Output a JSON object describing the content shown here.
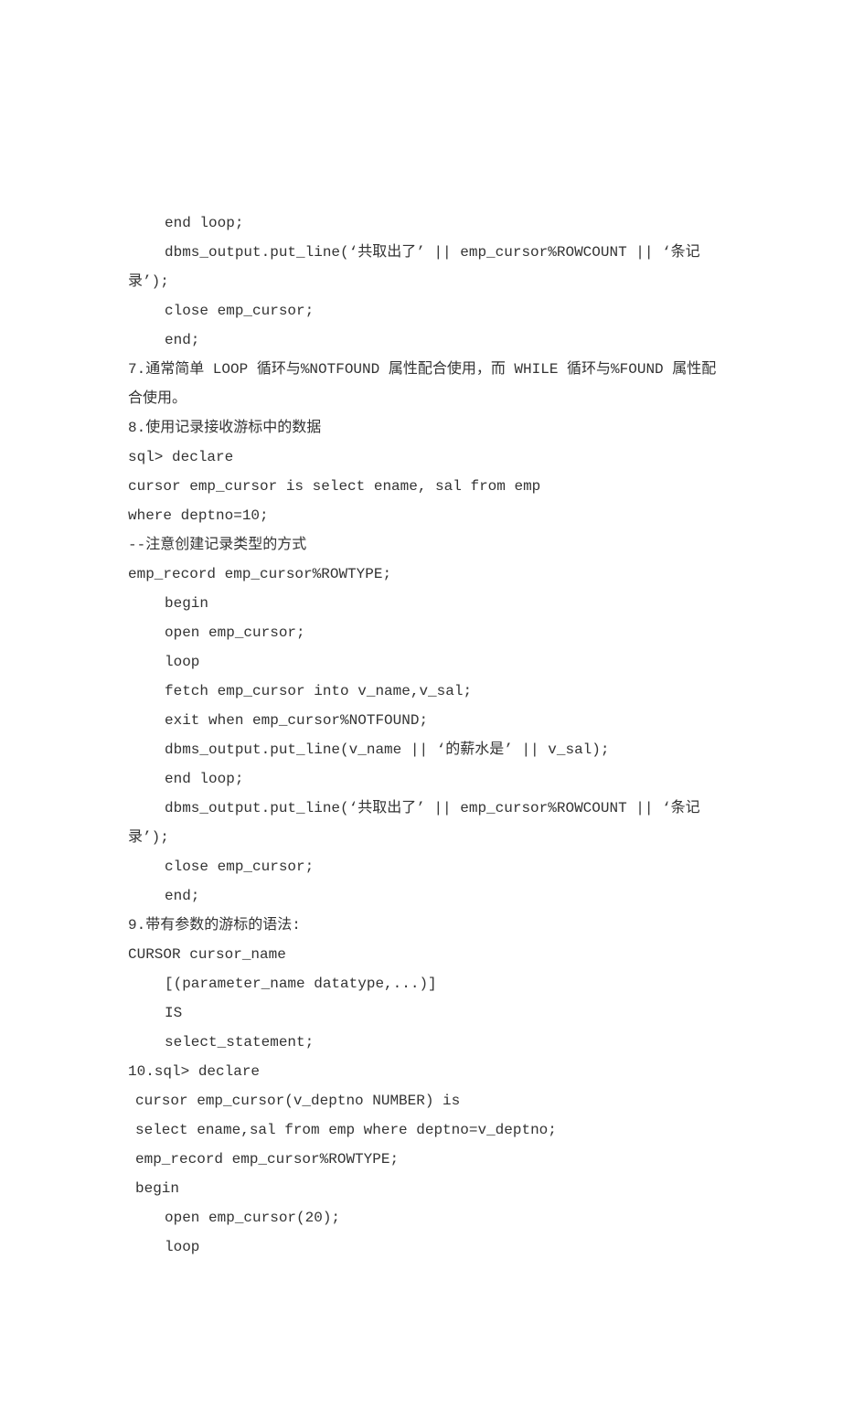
{
  "lines": [
    {
      "text": "end loop;",
      "indent": 1
    },
    {
      "text": "dbms_output.put_line(‘共取出了’ || emp_cursor%ROWCOUNT || ‘条记",
      "indent": 1
    },
    {
      "text": "录’);",
      "indent": 0
    },
    {
      "text": "close emp_cursor;",
      "indent": 1
    },
    {
      "text": "end;",
      "indent": 1
    },
    {
      "text": "7.通常简单 LOOP 循环与%NOTFOUND 属性配合使用，而 WHILE 循环与%FOUND 属性配",
      "indent": 0
    },
    {
      "text": "合使用。",
      "indent": 0
    },
    {
      "text": "8.使用记录接收游标中的数据",
      "indent": 0
    },
    {
      "text": "sql> declare",
      "indent": 0
    },
    {
      "text": "cursor emp_cursor is select ename, sal from emp",
      "indent": 0
    },
    {
      "text": "where deptno=10;",
      "indent": 0
    },
    {
      "text": "--注意创建记录类型的方式",
      "indent": 0
    },
    {
      "text": "emp_record emp_cursor%ROWTYPE;",
      "indent": 0
    },
    {
      "text": "begin",
      "indent": 1
    },
    {
      "text": "open emp_cursor;",
      "indent": 1
    },
    {
      "text": "loop",
      "indent": 1
    },
    {
      "text": "fetch emp_cursor into v_name,v_sal;",
      "indent": 1
    },
    {
      "text": "exit when emp_cursor%NOTFOUND;",
      "indent": 1
    },
    {
      "text": "dbms_output.put_line(v_name || ‘的薪水是’ || v_sal);",
      "indent": 1
    },
    {
      "text": "end loop;",
      "indent": 1
    },
    {
      "text": "dbms_output.put_line(‘共取出了’ || emp_cursor%ROWCOUNT || ‘条记",
      "indent": 1
    },
    {
      "text": "录’);",
      "indent": 0
    },
    {
      "text": "close emp_cursor;",
      "indent": 1
    },
    {
      "text": "end;",
      "indent": 1
    },
    {
      "text": "9.带有参数的游标的语法:",
      "indent": 0
    },
    {
      "text": "CURSOR cursor_name",
      "indent": 0
    },
    {
      "text": "[(parameter_name datatype,...)]",
      "indent": 1
    },
    {
      "text": "IS",
      "indent": 1
    },
    {
      "text": "select_statement;",
      "indent": 1
    },
    {
      "text": "10.sql> declare",
      "indent": 0
    },
    {
      "text": "cursor emp_cursor(v_deptno NUMBER) is",
      "indent": 0.5
    },
    {
      "text": "select ename,sal from emp where deptno=v_deptno;",
      "indent": 0.5
    },
    {
      "text": "emp_record emp_cursor%ROWTYPE;",
      "indent": 0.5
    },
    {
      "text": "begin",
      "indent": 0.5
    },
    {
      "text": "open emp_cursor(20);",
      "indent": 1
    },
    {
      "text": "loop",
      "indent": 1
    }
  ]
}
